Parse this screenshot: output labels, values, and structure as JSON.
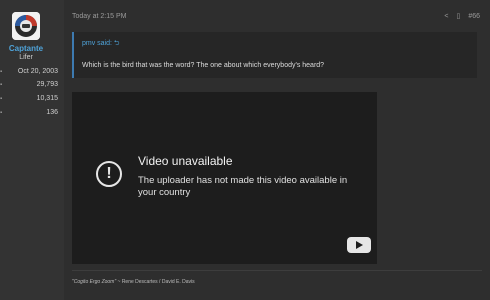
{
  "user": {
    "name": "Captante",
    "title": "Lifer",
    "stats": [
      {
        "icon": "calendar-icon",
        "value": "Oct 20, 2003"
      },
      {
        "icon": "messages-icon",
        "value": "29,793"
      },
      {
        "icon": "reactions-icon",
        "value": "10,315"
      },
      {
        "icon": "trophy-icon",
        "value": "136"
      }
    ]
  },
  "post": {
    "date": "Today at 2:15 PM",
    "share_glyph": "<",
    "bookmark_glyph": "▯",
    "number": "#66"
  },
  "quote": {
    "author": "pmv said:",
    "arrow": "⮌",
    "text": "Which is the bird that was the word? The one about which everybody's heard?"
  },
  "video": {
    "title": "Video unavailable",
    "message": "The uploader has not made this video available in your country",
    "status_glyph": "!"
  },
  "signature": {
    "quote": "\"Cogito Ergo Zoom\"",
    "attribution": " ~ Rene Descartes / David E. Davis"
  }
}
